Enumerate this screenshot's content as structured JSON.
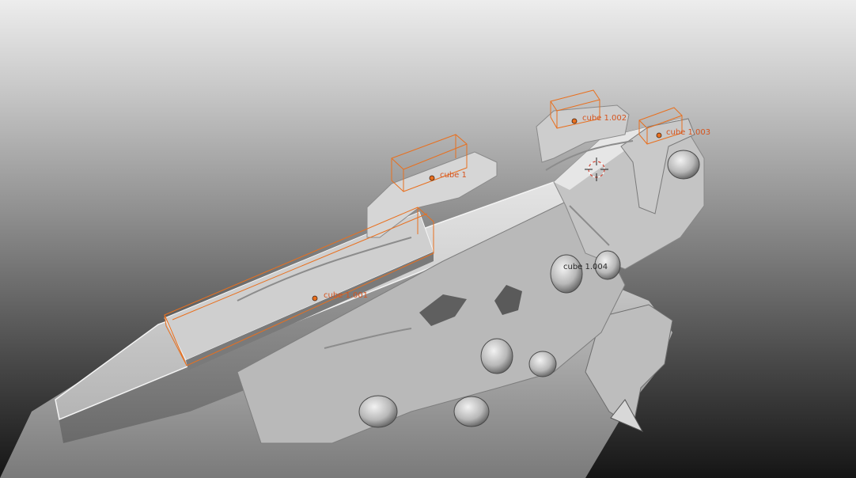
{
  "viewport": {
    "objects": [
      {
        "name": "cube 1.001",
        "selected": true
      },
      {
        "name": "cube 1",
        "selected": true
      },
      {
        "name": "cube 1.002",
        "selected": true
      },
      {
        "name": "cube 1.003",
        "selected": true
      },
      {
        "name": "cube 1.004",
        "selected": false
      }
    ]
  },
  "colors": {
    "selection_outline": "#e8701f",
    "label_selected": "#d5541e",
    "label_active": "#2a2a2a",
    "model_surface": "#c7c7c7",
    "background_top": "#ededed",
    "background_bottom": "#151515"
  },
  "icons": {
    "cursor": "3d-cursor-icon",
    "origin": "object-origin-icon"
  }
}
